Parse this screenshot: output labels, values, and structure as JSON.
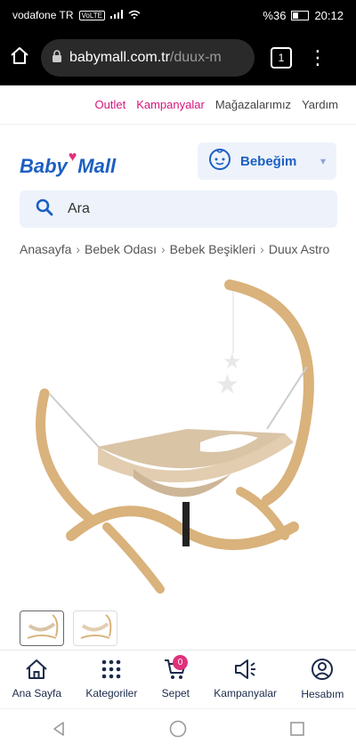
{
  "statusbar": {
    "carrier": "vodafone TR",
    "volte": "VoLTE",
    "battery": "%36",
    "time": "20:12"
  },
  "browser": {
    "url_host": "babymall.com.tr",
    "url_path": "/duux-m",
    "tab_count": "1"
  },
  "topnav": {
    "outlet": "Outlet",
    "campaigns": "Kampanyalar",
    "stores": "Mağazalarımız",
    "help": "Yardım"
  },
  "header": {
    "logo_baby": "Baby",
    "logo_mall": "Mall",
    "bebegim": "Bebeğim",
    "search_placeholder": "Ara"
  },
  "breadcrumb": [
    "Anasayfa",
    "Bebek Odası",
    "Bebek Beşikleri",
    "Duux Astro"
  ],
  "bottom_nav": {
    "home": "Ana Sayfa",
    "categories": "Kategoriler",
    "cart": "Sepet",
    "cart_count": "0",
    "campaigns": "Kampanyalar",
    "account": "Hesabım"
  },
  "colors": {
    "brand_blue": "#1c5fc2",
    "brand_pink": "#e0307d",
    "nav_pink": "#d6157e"
  }
}
